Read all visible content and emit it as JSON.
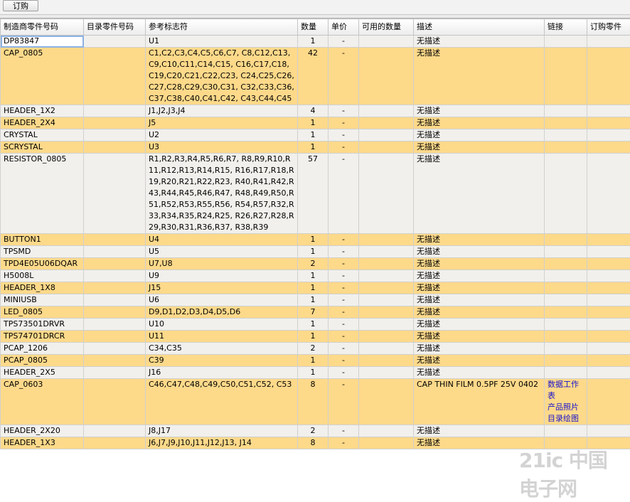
{
  "toolbar": {
    "order_label": "订购"
  },
  "columns": [
    "制造商零件号码",
    "目录零件号码",
    "参考标志符",
    "数量",
    "单价",
    "可用的数量",
    "描述",
    "链接",
    "订购零件"
  ],
  "rows": [
    {
      "mpn": "DP83847",
      "catalog": "",
      "refdes": "U1",
      "qty": "1",
      "price": "-",
      "avail": "",
      "desc": "无描述",
      "links": []
    },
    {
      "mpn": "CAP_0805",
      "catalog": "",
      "refdes": "C1,C2,C3,C4,C5,C6,C7, C8,C12,C13,C9,C10,C11,C14,C15, C16,C17,C18,C19,C20,C21,C22,C23, C24,C25,C26,C27,C28,C29,C30,C31, C32,C33,C36,C37,C38,C40,C41,C42, C43,C44,C45",
      "qty": "42",
      "price": "-",
      "avail": "",
      "desc": "无描述",
      "links": []
    },
    {
      "mpn": "HEADER_1X2",
      "catalog": "",
      "refdes": "J1,J2,J3,J4",
      "qty": "4",
      "price": "-",
      "avail": "",
      "desc": "无描述",
      "links": []
    },
    {
      "mpn": "HEADER_2X4",
      "catalog": "",
      "refdes": "J5",
      "qty": "1",
      "price": "-",
      "avail": "",
      "desc": "无描述",
      "links": []
    },
    {
      "mpn": "CRYSTAL",
      "catalog": "",
      "refdes": "U2",
      "qty": "1",
      "price": "-",
      "avail": "",
      "desc": "无描述",
      "links": []
    },
    {
      "mpn": "SCRYSTAL",
      "catalog": "",
      "refdes": "U3",
      "qty": "1",
      "price": "-",
      "avail": "",
      "desc": "无描述",
      "links": []
    },
    {
      "mpn": "RESISTOR_0805",
      "catalog": "",
      "refdes": "R1,R2,R3,R4,R5,R6,R7, R8,R9,R10,R11,R12,R13,R14,R15, R16,R17,R18,R19,R20,R21,R22,R23, R40,R41,R42,R43,R44,R45,R46,R47, R48,R49,R50,R51,R52,R53,R55,R56, R54,R57,R32,R33,R34,R35,R24,R25, R26,R27,R28,R29,R30,R31,R36,R37, R38,R39",
      "qty": "57",
      "price": "-",
      "avail": "",
      "desc": "无描述",
      "links": []
    },
    {
      "mpn": "BUTTON1",
      "catalog": "",
      "refdes": "U4",
      "qty": "1",
      "price": "-",
      "avail": "",
      "desc": "无描述",
      "links": []
    },
    {
      "mpn": "TPSMD",
      "catalog": "",
      "refdes": "U5",
      "qty": "1",
      "price": "-",
      "avail": "",
      "desc": "无描述",
      "links": []
    },
    {
      "mpn": "TPD4E05U06DQAR",
      "catalog": "",
      "refdes": "U7,U8",
      "qty": "2",
      "price": "-",
      "avail": "",
      "desc": "无描述",
      "links": []
    },
    {
      "mpn": "H5008L",
      "catalog": "",
      "refdes": "U9",
      "qty": "1",
      "price": "-",
      "avail": "",
      "desc": "无描述",
      "links": []
    },
    {
      "mpn": "HEADER_1X8",
      "catalog": "",
      "refdes": "J15",
      "qty": "1",
      "price": "-",
      "avail": "",
      "desc": "无描述",
      "links": []
    },
    {
      "mpn": "MINIUSB",
      "catalog": "",
      "refdes": "U6",
      "qty": "1",
      "price": "-",
      "avail": "",
      "desc": "无描述",
      "links": []
    },
    {
      "mpn": "LED_0805",
      "catalog": "",
      "refdes": "D9,D1,D2,D3,D4,D5,D6",
      "qty": "7",
      "price": "-",
      "avail": "",
      "desc": "无描述",
      "links": []
    },
    {
      "mpn": "TPS73501DRVR",
      "catalog": "",
      "refdes": "U10",
      "qty": "1",
      "price": "-",
      "avail": "",
      "desc": "无描述",
      "links": []
    },
    {
      "mpn": "TPS74701DRCR",
      "catalog": "",
      "refdes": "U11",
      "qty": "1",
      "price": "-",
      "avail": "",
      "desc": "无描述",
      "links": []
    },
    {
      "mpn": "PCAP_1206",
      "catalog": "",
      "refdes": "C34,C35",
      "qty": "2",
      "price": "-",
      "avail": "",
      "desc": "无描述",
      "links": []
    },
    {
      "mpn": "PCAP_0805",
      "catalog": "",
      "refdes": "C39",
      "qty": "1",
      "price": "-",
      "avail": "",
      "desc": "无描述",
      "links": []
    },
    {
      "mpn": "HEADER_2X5",
      "catalog": "",
      "refdes": "J16",
      "qty": "1",
      "price": "-",
      "avail": "",
      "desc": "无描述",
      "links": []
    },
    {
      "mpn": "CAP_0603",
      "catalog": "",
      "refdes": "C46,C47,C48,C49,C50,C51,C52, C53",
      "qty": "8",
      "price": "-",
      "avail": "",
      "desc": "CAP THIN FILM 0.5PF 25V 0402",
      "links": [
        "数据工作表",
        "产品照片",
        "目录绘图"
      ]
    },
    {
      "mpn": "HEADER_2X20",
      "catalog": "",
      "refdes": "J8,J17",
      "qty": "2",
      "price": "-",
      "avail": "",
      "desc": "无描述",
      "links": []
    },
    {
      "mpn": "HEADER_1X3",
      "catalog": "",
      "refdes": "J6,J7,J9,J10,J11,J12,J13, J14",
      "qty": "8",
      "price": "-",
      "avail": "",
      "desc": "无描述",
      "links": []
    }
  ],
  "watermark": "21ic 中国电子网"
}
